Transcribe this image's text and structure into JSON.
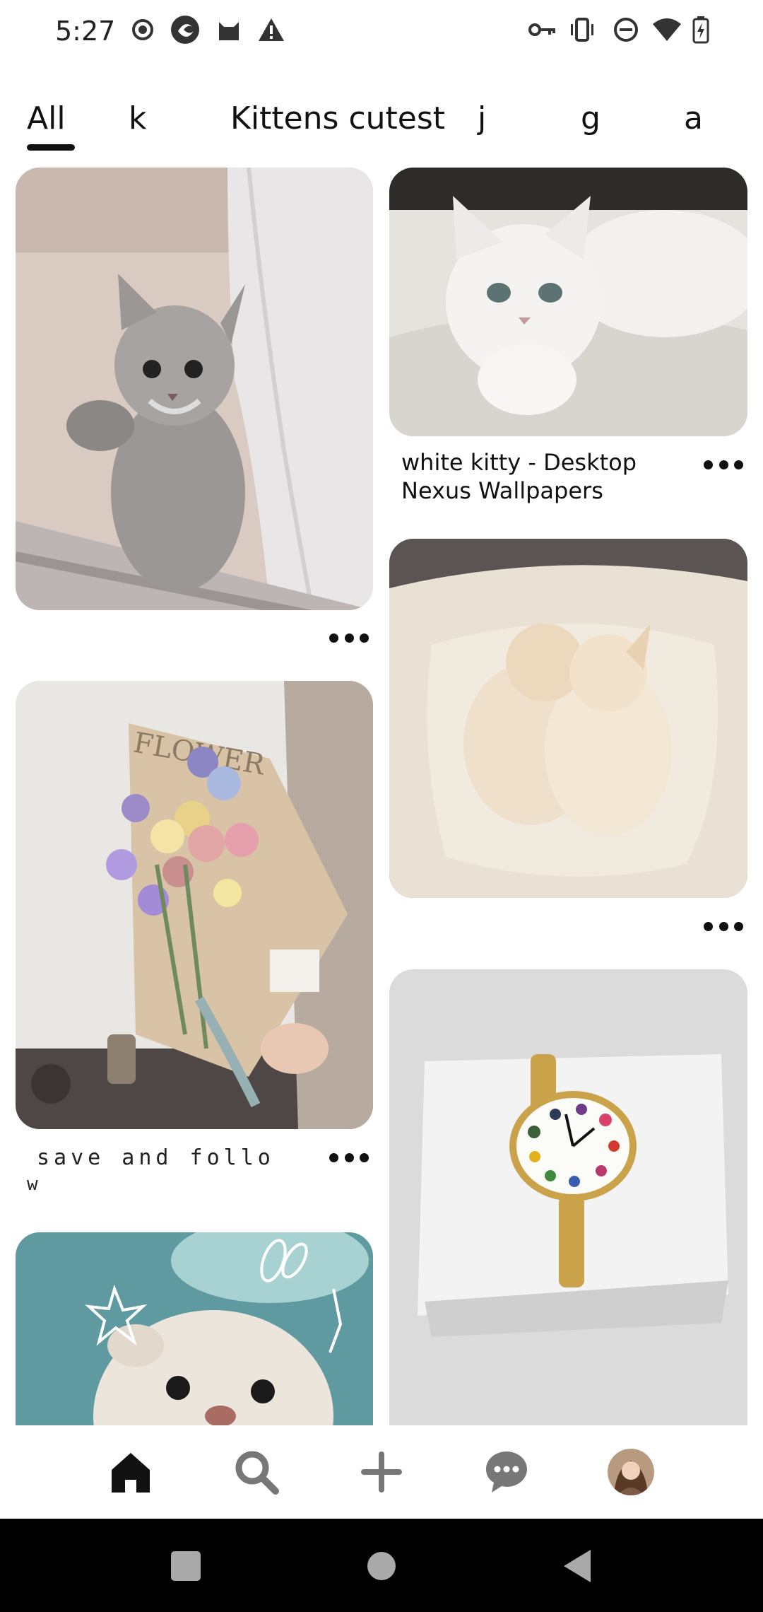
{
  "status_bar": {
    "time": "5:27",
    "left_icons": [
      "record-icon",
      "app-icon",
      "cat-icon",
      "warning-icon"
    ],
    "right_icons": [
      "key-icon",
      "vibrate-icon",
      "dnd-icon",
      "wifi-icon",
      "battery-icon"
    ]
  },
  "tabs": [
    {
      "label": "All",
      "selected": true
    },
    {
      "label": "k"
    },
    {
      "label": "Kittens cutest"
    },
    {
      "label": "j"
    },
    {
      "label": "g"
    },
    {
      "label": "a"
    }
  ],
  "pins": {
    "kitten_window": {
      "image": "tabby kitten at window"
    },
    "white_kitty": {
      "image": "white fluffy kitten",
      "title": "white kitty - Desktop Nexus Wallpapers"
    },
    "two_kittens": {
      "image": "two cream kittens in bed"
    },
    "flowers": {
      "image": "flower bouquet",
      "caption_line1": "save and follo",
      "caption_line2": "w"
    },
    "watch": {
      "image": "gold watch with palette face"
    },
    "otter": {
      "image": "cute otter with doodles"
    }
  },
  "bottom_nav": {
    "items": [
      "home-icon",
      "search-icon",
      "create-icon",
      "messages-icon",
      "profile-avatar"
    ],
    "active": "home-icon"
  },
  "system_nav": [
    "recents-button",
    "home-button",
    "back-button"
  ],
  "colors": {
    "text": "#111111",
    "nav_bar": "#000000",
    "tab_underline": "#111111"
  }
}
